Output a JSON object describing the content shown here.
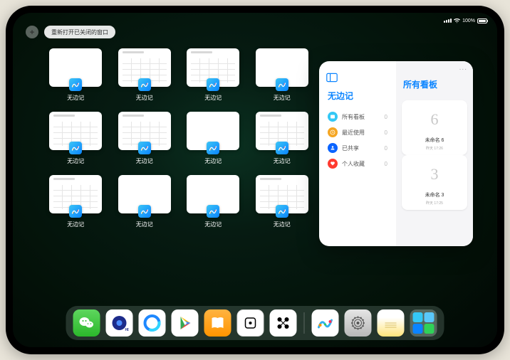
{
  "statusbar": {
    "battery": "100%"
  },
  "topbar": {
    "plus": "+",
    "reopen_label": "重新打开已关闭的窗口"
  },
  "windows": [
    {
      "label": "无边记",
      "type": "blank"
    },
    {
      "label": "无边记",
      "type": "grid"
    },
    {
      "label": "无边记",
      "type": "grid"
    },
    {
      "label": "无边记",
      "type": "blank"
    },
    {
      "label": "无边记",
      "type": "grid"
    },
    {
      "label": "无边记",
      "type": "grid"
    },
    {
      "label": "无边记",
      "type": "blank"
    },
    {
      "label": "无边记",
      "type": "grid"
    },
    {
      "label": "无边记",
      "type": "grid"
    },
    {
      "label": "无边记",
      "type": "blank"
    },
    {
      "label": "无边记",
      "type": "blank"
    },
    {
      "label": "无边记",
      "type": "grid"
    }
  ],
  "popover": {
    "title_left": "无边记",
    "title_right": "所有看板",
    "more": "...",
    "sidebar": [
      {
        "icon": "all",
        "color": "#34c8f5",
        "label": "所有看板",
        "count": "0"
      },
      {
        "icon": "recent",
        "color": "#f5a623",
        "label": "最近使用",
        "count": "0"
      },
      {
        "icon": "shared",
        "color": "#0a64ff",
        "label": "已共享",
        "count": "0"
      },
      {
        "icon": "fav",
        "color": "#ff3b30",
        "label": "个人收藏",
        "count": "0"
      }
    ],
    "boards": [
      {
        "sketch": "6",
        "title": "未命名 6",
        "time": "昨天 17:26"
      },
      {
        "sketch": "3",
        "title": "未命名 3",
        "time": "昨天 17:25"
      }
    ]
  },
  "dock": {
    "apps": [
      {
        "name": "wechat"
      },
      {
        "name": "quark"
      },
      {
        "name": "qqbrowser"
      },
      {
        "name": "play"
      },
      {
        "name": "books"
      },
      {
        "name": "dice"
      },
      {
        "name": "connect"
      },
      {
        "name": "freeform"
      },
      {
        "name": "settings"
      },
      {
        "name": "notes"
      },
      {
        "name": "folder"
      }
    ]
  }
}
